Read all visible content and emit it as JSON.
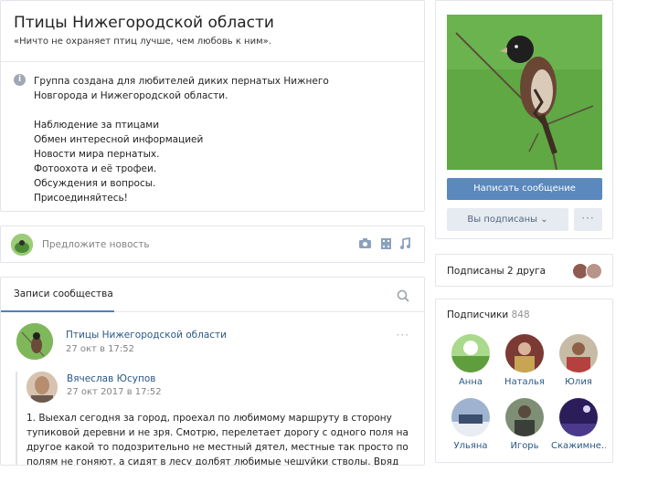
{
  "group": {
    "title": "Птицы Нижегородской области",
    "status": "«Ничто не охраняет птиц лучше, чем любовь к ним».",
    "info_icon": "info-icon",
    "description": "Группа создана для любителей диких пернатых Нижнего Новгорода и Нижегородской области.",
    "lines": [
      "Наблюдение за птицами",
      "Обмен интересной информацией",
      "Новости мира пернатых.",
      "Фотоохота и её трофеи.",
      "Обсуждения и вопросы.",
      "Присоединяйтесь!"
    ]
  },
  "suggest": {
    "placeholder": "Предложите новость",
    "icons": [
      "camera-icon",
      "video-icon",
      "music-icon"
    ]
  },
  "wall": {
    "tab": "Записи сообщества",
    "post": {
      "author": "Птицы Нижегородской области",
      "date": "27 окт в 17:52",
      "more": "···",
      "repost_author": "Вячеслав Юсупов",
      "repost_date": "27 окт 2017 в 17:52",
      "text": "1. Выехал сегодня за город, проехал по любимому маршруту в сторону тупиковой деревни и не зря. Смотрю, перелетает дорогу с одного поля на другое какой то подозрительно не местный дятел, местные так просто по полям не гоняют, а сидят в лесу долбят любимые чешуйки стволы. Вряд ли на"
    }
  },
  "cover": {
    "message_button": "Написать сообщение",
    "subscribed_button": "Вы подписаны",
    "more_button": "···"
  },
  "friends": {
    "label": "Подписаны 2 друга"
  },
  "followers": {
    "title": "Подписчики",
    "count": "848",
    "people": [
      {
        "name": "Анна",
        "color": "#8cc063"
      },
      {
        "name": "Наталья",
        "color": "#b9473b"
      },
      {
        "name": "Юлия",
        "color": "#b07a6a"
      },
      {
        "name": "Ульяна",
        "color": "#6f86a8"
      },
      {
        "name": "Игорь",
        "color": "#5d6c5a"
      },
      {
        "name": "Скажимне…",
        "color": "#2e1f5e"
      }
    ]
  },
  "colors": {
    "accent": "#5181b8",
    "link": "#2a5885"
  }
}
